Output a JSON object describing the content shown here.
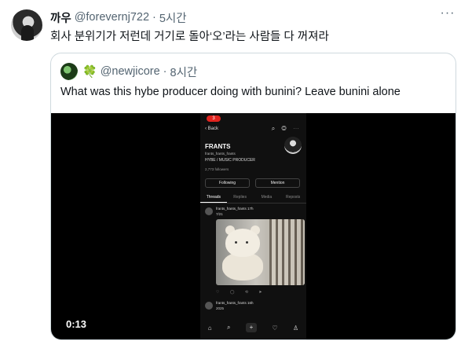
{
  "tweet": {
    "author_name": "까우",
    "handle": "@forevernj722",
    "separator": "·",
    "time": "5시간",
    "more": "···",
    "text": "회사 분위기가 저런데 거기로 돌아‘오’라는 사람들 다 꺼져라"
  },
  "quote": {
    "emoji": "🍀",
    "handle": "@newjicore",
    "separator": "·",
    "time": "8시간",
    "text": "What was this hybe producer doing with bunini? Leave bunini alone",
    "video": {
      "duration": "0:13",
      "phone": {
        "status": "3",
        "back": "‹ Back",
        "icons": "⌕ ◎ ⋯",
        "profile_name": "FRANTS",
        "profile_sub": "frants_frants_frants",
        "bio": "HYBE / MUSIC PRODUCER",
        "followers": "2,773 followers",
        "follow_btn": "Following",
        "mention_btn": "Mention",
        "tabs": [
          "Threads",
          "Replies",
          "Media",
          "Reposts"
        ],
        "post_user": "frants_frants_frants 17h",
        "post_text": "7/21",
        "actions": "♡ ◯ ⟲ ➤",
        "post2_user": "frants_frants_frants 16h",
        "post2_text": "2025",
        "nav": [
          "⌂",
          "⌕",
          "+",
          "♡",
          "♙"
        ]
      }
    }
  }
}
